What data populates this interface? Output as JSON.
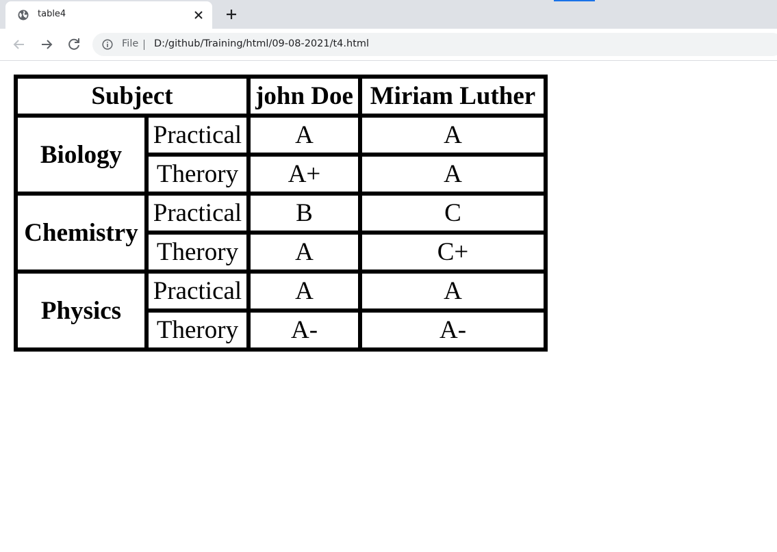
{
  "browser": {
    "tab_title": "table4",
    "address": {
      "scheme_label": "File",
      "url": "D:/github/Training/html/09-08-2021/t4.html"
    },
    "icons": {
      "favicon": "globe-icon",
      "close": "close-icon",
      "new_tab": "plus-icon",
      "back": "arrow-left-icon",
      "forward": "arrow-right-icon",
      "reload": "reload-icon",
      "info": "info-icon"
    }
  },
  "table": {
    "header": {
      "subject": "Subject",
      "student1": "john Doe",
      "student2": "Miriam Luther"
    },
    "subjects": [
      {
        "name": "Biology",
        "rows": [
          {
            "kind": "Practical",
            "s1": "A",
            "s2": "A"
          },
          {
            "kind": "Therory",
            "s1": "A+",
            "s2": "A"
          }
        ]
      },
      {
        "name": "Chemistry",
        "rows": [
          {
            "kind": "Practical",
            "s1": "B",
            "s2": "C"
          },
          {
            "kind": "Therory",
            "s1": "A",
            "s2": "C+"
          }
        ]
      },
      {
        "name": "Physics",
        "rows": [
          {
            "kind": "Practical",
            "s1": "A",
            "s2": "A"
          },
          {
            "kind": "Therory",
            "s1": "A-",
            "s2": "A-"
          }
        ]
      }
    ]
  }
}
